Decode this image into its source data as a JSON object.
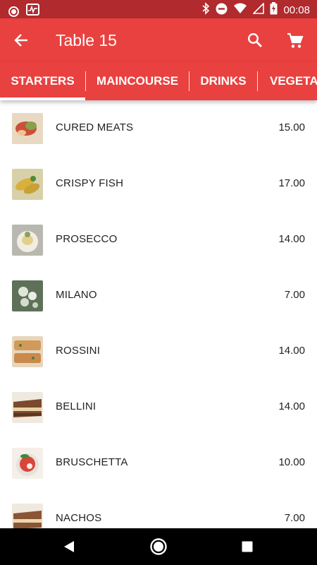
{
  "status_bar": {
    "time": "00:08",
    "left_icons": [
      "record-icon",
      "activity-icon"
    ],
    "right_icons": [
      "bluetooth-icon",
      "do-not-disturb-icon",
      "wifi-icon",
      "signal-icon",
      "battery-charging-icon"
    ]
  },
  "app_bar": {
    "title": "Table 15",
    "back_icon": "arrow-back-icon",
    "search_icon": "search-icon",
    "cart_icon": "cart-icon"
  },
  "tabs": [
    {
      "label": "STARTERS",
      "selected": true
    },
    {
      "label": "MAINCOURSE",
      "selected": false
    },
    {
      "label": "DRINKS",
      "selected": false
    },
    {
      "label": "VEGETA",
      "selected": false
    }
  ],
  "items": [
    {
      "name": "CURED MEATS",
      "price": "15.00"
    },
    {
      "name": "CRISPY FISH",
      "price": "17.00"
    },
    {
      "name": "PROSECCO",
      "price": "14.00"
    },
    {
      "name": "MILANO",
      "price": "7.00"
    },
    {
      "name": "ROSSINI",
      "price": "14.00"
    },
    {
      "name": "BELLINI",
      "price": "14.00"
    },
    {
      "name": "BRUSCHETTA",
      "price": "10.00"
    },
    {
      "name": "NACHOS",
      "price": "7.00"
    }
  ],
  "colors": {
    "app_bar": "#e8413f",
    "status_bar": "#b02a2e",
    "nav_bar": "#000000"
  },
  "nav_bar": {
    "icons": [
      "back-triangle-icon",
      "home-circle-icon",
      "recents-square-icon"
    ]
  }
}
